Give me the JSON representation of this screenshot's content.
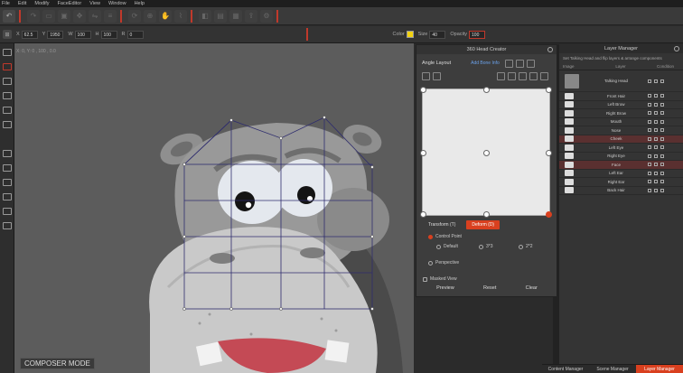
{
  "menubar": {
    "items": [
      "File",
      "Edit",
      "Modify",
      "FaceEditor",
      "View",
      "Window",
      "Help"
    ]
  },
  "toolbar2": {
    "x_label": "X",
    "x_val": "62.5",
    "y_label": "Y",
    "y_val": "1950",
    "w_label": "W",
    "w_val": "100",
    "h_label": "H",
    "h_val": "100",
    "r_label": "R",
    "r_val": "0",
    "color_label": "Color",
    "size_label": "Size",
    "size_val": "40",
    "opacity_label": "Opacity",
    "opacity_val": "100",
    "color_accent": "#f2d211"
  },
  "canvas": {
    "coord": "X: 0, Y: 0 , 100 , 0.0",
    "mode": "COMPOSER MODE"
  },
  "head_creator": {
    "title": "360 Head Creator",
    "angle_label": "Angle Layout",
    "link": "Add Bone Info",
    "tabs": [
      "Transform (T)",
      "Deform (D)"
    ],
    "control_point": "Control Point",
    "default": "Default",
    "three": "3*3",
    "two": "2*2",
    "perspective": "Perspective",
    "masked_view": "Masked View",
    "buttons": [
      "Preview",
      "Reset",
      "Clear"
    ]
  },
  "layer_manager": {
    "title": "Layer Manager",
    "info": "Set Talking Head and flip layers & arrange components",
    "col_image": "Image",
    "col_layer": "Layer",
    "col_condition": "Condition",
    "group_name": "Talking Head",
    "layers": [
      {
        "name": "Front Hair",
        "hl": false
      },
      {
        "name": "Left Brow",
        "hl": false
      },
      {
        "name": "Right Brow",
        "hl": false
      },
      {
        "name": "Mouth",
        "hl": false
      },
      {
        "name": "Nose",
        "hl": false
      },
      {
        "name": "Cheek",
        "hl": true
      },
      {
        "name": "Left Eye",
        "hl": false
      },
      {
        "name": "Right Eye",
        "hl": false
      },
      {
        "name": "Face",
        "hl": true
      },
      {
        "name": "Left Ear",
        "hl": false
      },
      {
        "name": "Right Ear",
        "hl": false
      },
      {
        "name": "Back Hair",
        "hl": false
      }
    ],
    "bottom_tabs": [
      "Content Manager",
      "Scene Manager",
      "Layer Manager"
    ]
  },
  "colors": {
    "accent": "#d9401f",
    "hippo": "#9a9a9a",
    "mouth": "#c44a55"
  }
}
